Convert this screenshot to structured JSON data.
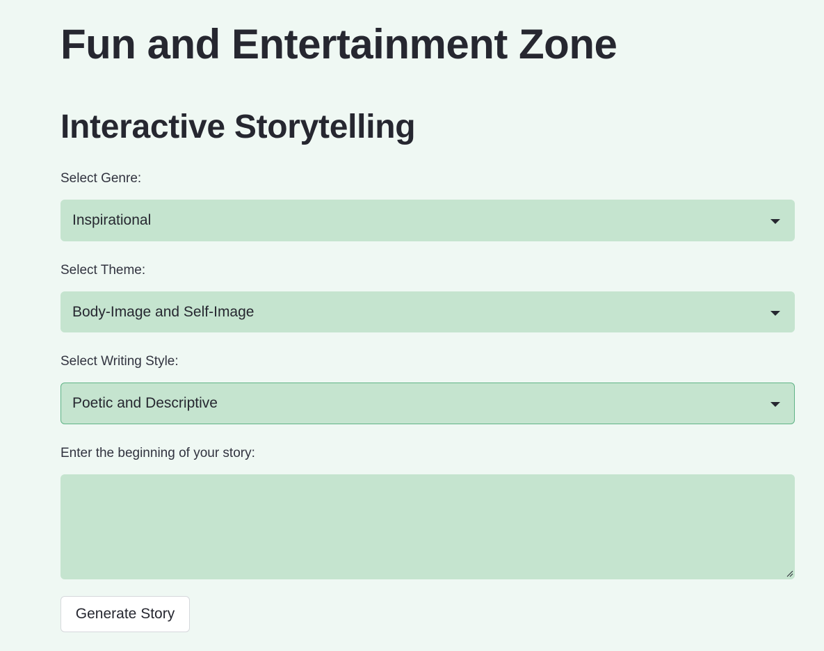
{
  "page": {
    "title": "Fun and Entertainment Zone",
    "section_title": "Interactive Storytelling"
  },
  "form": {
    "genre": {
      "label": "Select Genre:",
      "value": "Inspirational"
    },
    "theme": {
      "label": "Select Theme:",
      "value": "Body-Image and Self-Image"
    },
    "writing_style": {
      "label": "Select Writing Style:",
      "value": "Poetic and Descriptive"
    },
    "story_beginning": {
      "label": "Enter the beginning of your story:",
      "value": ""
    },
    "generate_button_label": "Generate Story"
  },
  "icons": {
    "select_arrow": "chevron-down-icon",
    "textarea_resize": "resize-handle-icon"
  },
  "colors": {
    "background": "#eff8f3",
    "input_background": "#c5e4cf",
    "focus_border": "#5fb386",
    "text": "#262730"
  }
}
